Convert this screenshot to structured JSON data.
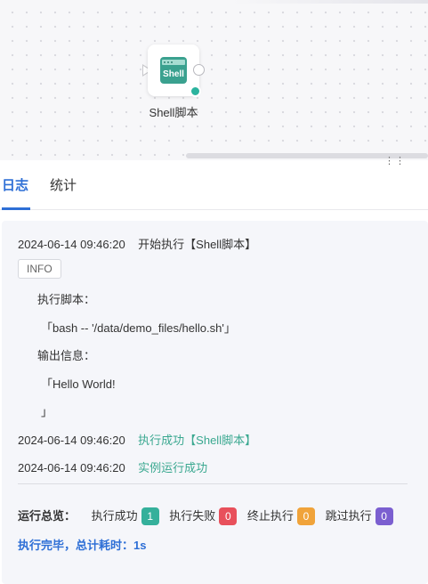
{
  "canvas": {
    "node": {
      "icon_text": "Shell",
      "label": "Shell脚本"
    }
  },
  "panel": {
    "resize_handle": "⋮⋮",
    "tabs": [
      {
        "label": "日志",
        "active": true
      },
      {
        "label": "统计",
        "active": false
      }
    ],
    "log": {
      "line1": {
        "time": "2024-06-14 09:46:20",
        "text": "开始执行【Shell脚本】"
      },
      "badge": "INFO",
      "exec_label": "执行脚本：",
      "exec_cmd": "「bash -- '/data/demo_files/hello.sh'」",
      "output_label": "输出信息：",
      "output_value": "「Hello World!",
      "output_close": "」",
      "line2": {
        "time": "2024-06-14 09:46:20",
        "text": "执行成功【Shell脚本】"
      },
      "line3": {
        "time": "2024-06-14 09:46:20",
        "text": "实例运行成功"
      }
    },
    "summary": {
      "label": "运行总览：",
      "success_label": "执行成功",
      "success_count": "1",
      "fail_label": "执行失败",
      "fail_count": "0",
      "stop_label": "终止执行",
      "stop_count": "0",
      "skip_label": "跳过执行",
      "skip_count": "0",
      "done_text": "执行完毕，总计耗时：1s"
    },
    "colors": {
      "accent": "#2e6fd6",
      "success": "#35b09b",
      "fail": "#e8505b",
      "stop": "#f0a33a",
      "skip": "#7b5fd0"
    }
  }
}
